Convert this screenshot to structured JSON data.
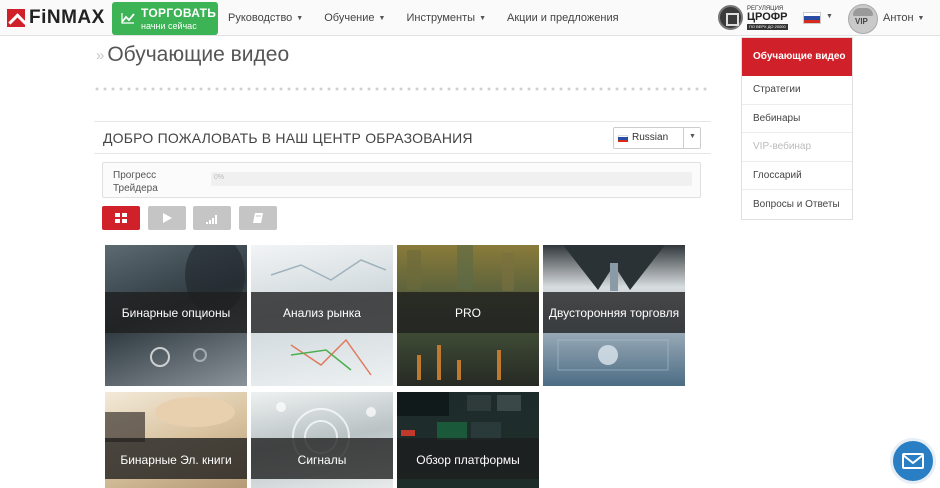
{
  "header": {
    "logo_text": "FiNMAX",
    "trade_button": {
      "title": "ТОРГОВАТЬ",
      "subtitle": "начни сейчас"
    },
    "nav": [
      {
        "label": "Руководство",
        "has_dropdown": true
      },
      {
        "label": "Обучение",
        "has_dropdown": true
      },
      {
        "label": "Инструменты",
        "has_dropdown": true
      },
      {
        "label": "Акции и предложения",
        "has_dropdown": false
      }
    ],
    "regulator": {
      "line1": "РЕГУЛЯЦИЯ",
      "line2": "ЦРОФР",
      "line3": "ПО ВЕРХ ДО 20000"
    },
    "language_flag": "russia-flag-icon",
    "user": {
      "name": "Антон",
      "avatar_badge": "VIP"
    }
  },
  "page": {
    "title": "Обучающие видео"
  },
  "welcome": {
    "title": "ДОБРО ПОЖАЛОВАТЬ В НАШ ЦЕНТР ОБРАЗОВАНИЯ",
    "language_select": {
      "selected": "Russian"
    }
  },
  "progress": {
    "label_line1": "Прогресс",
    "label_line2": "Трейдера",
    "percent_text": "0%",
    "value": 0
  },
  "filters": [
    {
      "name": "grid-view",
      "icon": "grid-icon",
      "active": true
    },
    {
      "name": "video",
      "icon": "play-icon",
      "active": false
    },
    {
      "name": "signals",
      "icon": "signal-bars-icon",
      "active": false
    },
    {
      "name": "books",
      "icon": "book-icon",
      "active": false
    }
  ],
  "tiles": [
    {
      "label": "Бинарные опционы"
    },
    {
      "label": "Анализ рынка"
    },
    {
      "label": "PRO"
    },
    {
      "label": "Двусторонняя торговля"
    },
    {
      "label": "Бинарные Эл. книги"
    },
    {
      "label": "Сигналы"
    },
    {
      "label": "Обзор платформы"
    }
  ],
  "side_menu": [
    {
      "label": "Обучающие видео",
      "state": "active"
    },
    {
      "label": "Стратегии",
      "state": "normal"
    },
    {
      "label": "Вебинары",
      "state": "normal"
    },
    {
      "label": "VIP-вебинар",
      "state": "disabled"
    },
    {
      "label": "Глоссарий",
      "state": "normal"
    },
    {
      "label": "Вопросы и Ответы",
      "state": "normal"
    }
  ],
  "colors": {
    "brand_red": "#d0202a",
    "trade_green": "#3cb455",
    "chat_blue": "#2a7fc4"
  }
}
